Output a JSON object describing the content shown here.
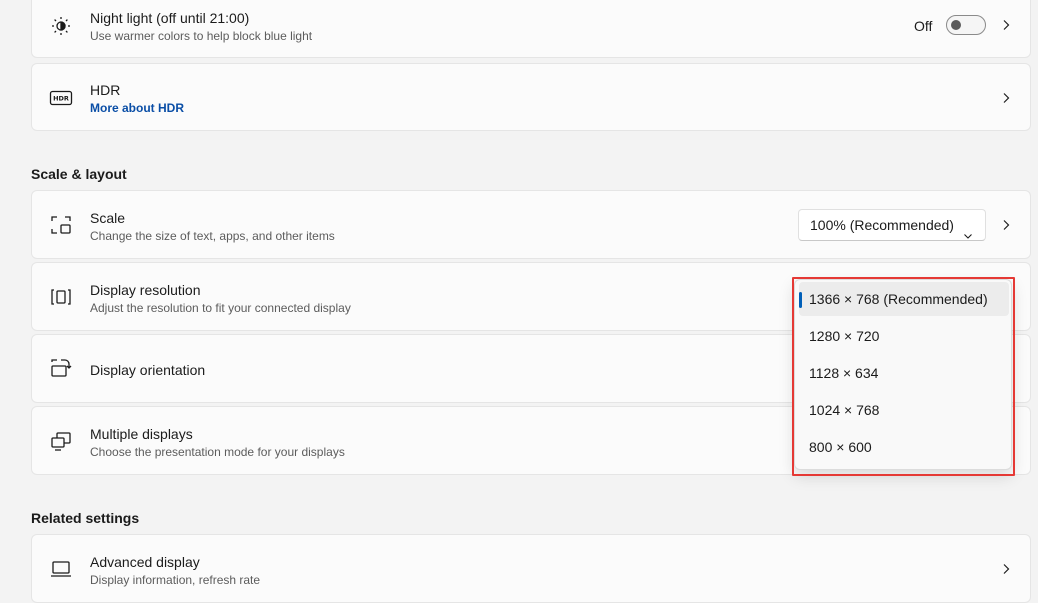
{
  "night_light": {
    "title": "Night light (off until 21:00)",
    "description": "Use warmer colors to help block blue light",
    "toggle_label": "Off"
  },
  "hdr": {
    "title": "HDR",
    "link": "More about HDR",
    "badge": "HDR"
  },
  "scale_layout": {
    "section_title": "Scale & layout",
    "scale": {
      "title": "Scale",
      "description": "Change the size of text, apps, and other items",
      "value": "100% (Recommended)"
    },
    "resolution": {
      "title": "Display resolution",
      "description": "Adjust the resolution to fit your connected display",
      "options": [
        "1366 × 768 (Recommended)",
        "1280 × 720",
        "1128 × 634",
        "1024 × 768",
        "800 × 600"
      ],
      "selected_index": 0
    },
    "orientation": {
      "title": "Display orientation"
    },
    "multiple": {
      "title": "Multiple displays",
      "description": "Choose the presentation mode for your displays"
    }
  },
  "related": {
    "section_title": "Related settings",
    "advanced": {
      "title": "Advanced display",
      "description": "Display information, refresh rate"
    }
  },
  "colors": {
    "accent": "#005fb8",
    "link": "#0a4ea6",
    "highlight": "#e53935"
  }
}
